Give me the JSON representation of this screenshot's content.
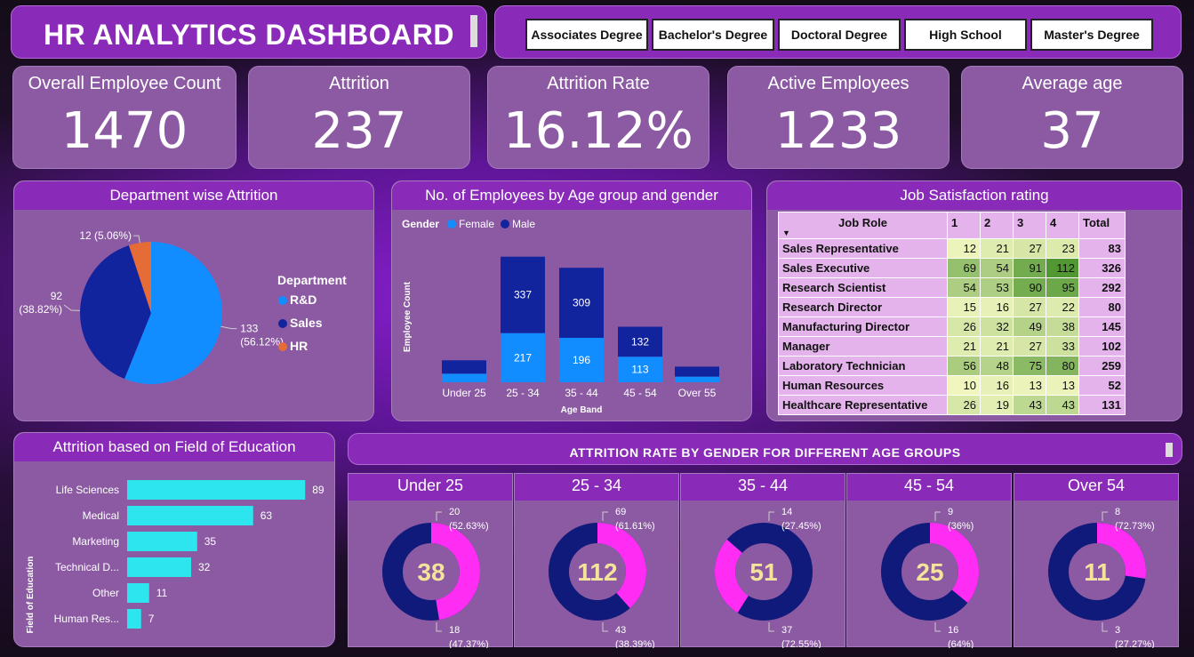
{
  "header": {
    "title": "HR ANALYTICS DASHBOARD"
  },
  "education_slicer": [
    "Associates Degree",
    "Bachelor's Degree",
    "Doctoral Degree",
    "High School",
    "Master's Degree"
  ],
  "kpis": [
    {
      "label": "Overall Employee Count",
      "value": "1470"
    },
    {
      "label": "Attrition",
      "value": "237"
    },
    {
      "label": "Attrition Rate",
      "value": "16.12%"
    },
    {
      "label": "Active Employees",
      "value": "1233"
    },
    {
      "label": "Average age",
      "value": "37"
    }
  ],
  "colors": {
    "rd": "#118dff",
    "sales": "#12239e",
    "hr": "#e66c37",
    "female": "#118dff",
    "male": "#12239e",
    "bar": "#2de5ee",
    "donut_male": "#101a7a",
    "donut_female": "#ff2df3"
  },
  "chart_data": [
    {
      "type": "pie",
      "title": "Department wise Attrition",
      "legend_title": "Department",
      "legend_position": "right",
      "slices": [
        {
          "name": "R&D",
          "value": 133,
          "label": "133",
          "pct": "(56.12%)"
        },
        {
          "name": "Sales",
          "value": 92,
          "label": "92",
          "pct": "(38.82%)"
        },
        {
          "name": "HR",
          "value": 12,
          "label": "12 (5.06%)",
          "pct": ""
        }
      ]
    },
    {
      "type": "bar",
      "stacked": true,
      "title": "No. of Employees by Age group and gender",
      "legend_title": "Gender",
      "xlabel": "Age Band",
      "ylabel": "Employee Count",
      "categories": [
        "Under 25",
        "25 - 34",
        "35 - 44",
        "45 - 54",
        "Over 55"
      ],
      "series": [
        {
          "name": "Female",
          "values": [
            38,
            217,
            196,
            113,
            25
          ],
          "labels": [
            "",
            "217",
            "196",
            "113",
            ""
          ]
        },
        {
          "name": "Male",
          "values": [
            59,
            337,
            309,
            132,
            44
          ],
          "labels": [
            "",
            "337",
            "309",
            "132",
            ""
          ]
        }
      ]
    },
    {
      "type": "table",
      "title": "Job Satisfaction rating",
      "columns": [
        "Job Role",
        "1",
        "2",
        "3",
        "4",
        "Total"
      ],
      "rows": [
        [
          "Sales Representative",
          12,
          21,
          27,
          23,
          83
        ],
        [
          "Sales Executive",
          69,
          54,
          91,
          112,
          326
        ],
        [
          "Research Scientist",
          54,
          53,
          90,
          95,
          292
        ],
        [
          "Research Director",
          15,
          16,
          27,
          22,
          80
        ],
        [
          "Manufacturing Director",
          26,
          32,
          49,
          38,
          145
        ],
        [
          "Manager",
          21,
          21,
          27,
          33,
          102
        ],
        [
          "Laboratory Technician",
          56,
          48,
          75,
          80,
          259
        ],
        [
          "Human Resources",
          10,
          16,
          13,
          13,
          52
        ],
        [
          "Healthcare Representative",
          26,
          19,
          43,
          43,
          131
        ]
      ]
    },
    {
      "type": "bar",
      "orientation": "horizontal",
      "title": "Attrition based on Field of Education",
      "ylabel": "Field of Education",
      "categories": [
        "Life Sciences",
        "Medical",
        "Marketing",
        "Technical D...",
        "Other",
        "Human Res..."
      ],
      "values": [
        89,
        63,
        35,
        32,
        11,
        7
      ]
    },
    {
      "type": "pie",
      "donut": true,
      "title": "ATTRITION RATE BY GENDER FOR DIFFERENT AGE GROUPS",
      "groups": [
        {
          "name": "Under 25",
          "total": "38",
          "male": 20,
          "male_pct": "(52.63%)",
          "female": 18,
          "female_pct": "(47.37%)"
        },
        {
          "name": "25 - 34",
          "total": "112",
          "male": 69,
          "male_pct": "(61.61%)",
          "female": 43,
          "female_pct": "(38.39%)"
        },
        {
          "name": "35 - 44",
          "total": "51",
          "male": 37,
          "male_pct": "(72.55%)",
          "female": 14,
          "female_pct": "(27.45%)"
        },
        {
          "name": "45 - 54",
          "total": "25",
          "male": 16,
          "male_pct": "(64%)",
          "female": 9,
          "female_pct": "(36%)"
        },
        {
          "name": "Over 54",
          "total": "11",
          "male": 8,
          "male_pct": "(72.73%)",
          "female": 3,
          "female_pct": "(27.27%)"
        }
      ]
    }
  ]
}
